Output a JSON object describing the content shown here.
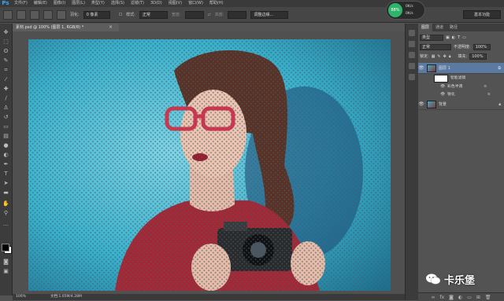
{
  "app": {
    "logo": "Ps"
  },
  "menubar": {
    "items": [
      "文件(F)",
      "编辑(E)",
      "图像(I)",
      "图层(L)",
      "类型(Y)",
      "选择(S)",
      "滤镜(T)",
      "3D(D)",
      "视图(V)",
      "窗口(W)",
      "帮助(H)"
    ]
  },
  "options": {
    "feather_label": "羽化:",
    "feather_value": "0 像素",
    "style_label": "样式:",
    "style_value": "正常",
    "width_label": "宽度:",
    "height_label": "高度:",
    "refine_edge": "调整边缘...",
    "essentials": "基本功能"
  },
  "perf": {
    "percent": "88%",
    "line1": "0K/s",
    "line2": "0K/s"
  },
  "document": {
    "tab_title": "素材.psd @ 100% (图层 1, RGB/8) *",
    "close_glyph": "×"
  },
  "status": {
    "zoom": "100%",
    "doc_info": "文档:1.05M/4.28M"
  },
  "panel": {
    "tabs": [
      "图层",
      "通道",
      "路径"
    ],
    "kind_label": "类型",
    "blend_mode": "正常",
    "opacity_label": "不透明度:",
    "opacity_value": "100%",
    "lock_label": "锁定:",
    "fill_label": "填充:",
    "fill_value": "100%",
    "layers": [
      {
        "name": "图层 1",
        "selected": true
      },
      {
        "name": "背景",
        "selected": false
      }
    ],
    "sublayers": [
      "智能滤镜",
      "彩色半调",
      "锐化"
    ]
  },
  "watermark": {
    "text": "卡乐堡"
  },
  "colors": {
    "accent": "#31a8ff",
    "selected_layer": "#5b7aa1",
    "perf_green": "#2fb56a",
    "artwork_bg": "#39b3cf"
  }
}
